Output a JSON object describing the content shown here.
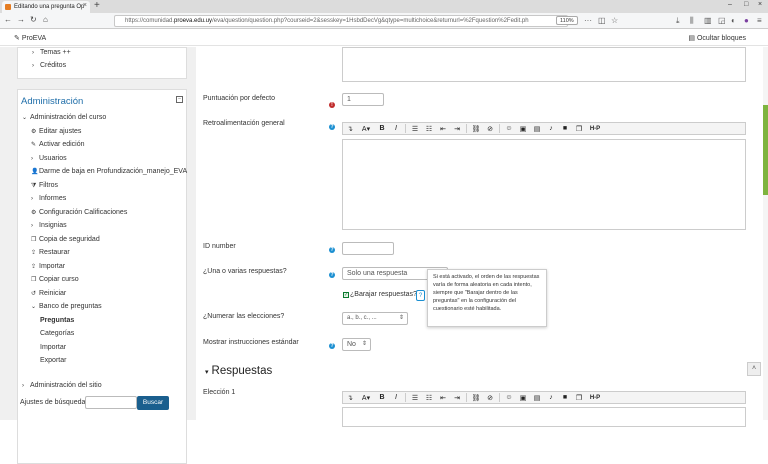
{
  "browser": {
    "tab_title": "Editando una pregunta Op",
    "url_prefix": "https://comunidad.",
    "url_domain": "proeva.edu.uy",
    "url_rest": "/eva/question/question.php?courseid=2&sesskey=1HsbdDecVg&qtype=multichoice&returnurl=%2Fquestion%2Fedit.ph",
    "zoom": "110%"
  },
  "header": {
    "brand": "ProEVA",
    "hide_blocks": "Ocultar bloques"
  },
  "sidebar": {
    "top_items": [
      "Temas ++",
      "Créditos"
    ],
    "admin_title": "Administración",
    "items": [
      {
        "label": "Administración del curso",
        "icon": "chevron-down",
        "indent": 0
      },
      {
        "label": "Editar ajustes",
        "icon": "gear",
        "indent": 1
      },
      {
        "label": "Activar edición",
        "icon": "pencil",
        "indent": 1
      },
      {
        "label": "Usuarios",
        "icon": "chevron-right",
        "indent": 1
      },
      {
        "label": "Darme de baja en Profundización_manejo_EVA",
        "icon": "user",
        "indent": 1
      },
      {
        "label": "Filtros",
        "icon": "filter",
        "indent": 1
      },
      {
        "label": "Informes",
        "icon": "chevron-right",
        "indent": 1
      },
      {
        "label": "Configuración Calificaciones",
        "icon": "gear",
        "indent": 1
      },
      {
        "label": "Insignias",
        "icon": "chevron-right",
        "indent": 1
      },
      {
        "label": "Copia de seguridad",
        "icon": "copy",
        "indent": 1
      },
      {
        "label": "Restaurar",
        "icon": "upload",
        "indent": 1
      },
      {
        "label": "Importar",
        "icon": "upload",
        "indent": 1
      },
      {
        "label": "Copiar curso",
        "icon": "copy",
        "indent": 1
      },
      {
        "label": "Reiniciar",
        "icon": "reset",
        "indent": 1
      },
      {
        "label": "Banco de preguntas",
        "icon": "chevron-down",
        "indent": 1
      },
      {
        "label": "Preguntas",
        "icon": "",
        "indent": 2,
        "bold": true
      },
      {
        "label": "Categorías",
        "icon": "",
        "indent": 2
      },
      {
        "label": "Importar",
        "icon": "",
        "indent": 2
      },
      {
        "label": "Exportar",
        "icon": "",
        "indent": 2
      }
    ],
    "site_admin": "Administración del sitio",
    "search_label": "Ajustes de búsqueda",
    "search_button": "Buscar"
  },
  "form": {
    "default_score_label": "Puntuación por defecto",
    "default_score_value": "1",
    "general_feedback_label": "Retroalimentación general",
    "id_number_label": "ID number",
    "single_label": "¿Una o varias respuestas?",
    "single_value": "Solo una respuesta",
    "shuffle_label": "¿Barajar respuestas?",
    "tooltip": "Si está activado, el orden de las respuestas varía de forma aleatoria en cada intento, siempre que \"Barajar dentro de las preguntas\" en la configuración del cuestionario esté habilitada.",
    "numbering_label": "¿Numerar las elecciones?",
    "numbering_value": "a., b., c., ...",
    "show_instructions_label": "Mostrar instrucciones estándar",
    "show_instructions_value": "No",
    "section_title": "Respuestas",
    "choice_label": "Elección 1"
  },
  "colors": {
    "link": "#1f6ea9",
    "accent": "#7eb43f",
    "search_button": "#1a5f8e"
  }
}
